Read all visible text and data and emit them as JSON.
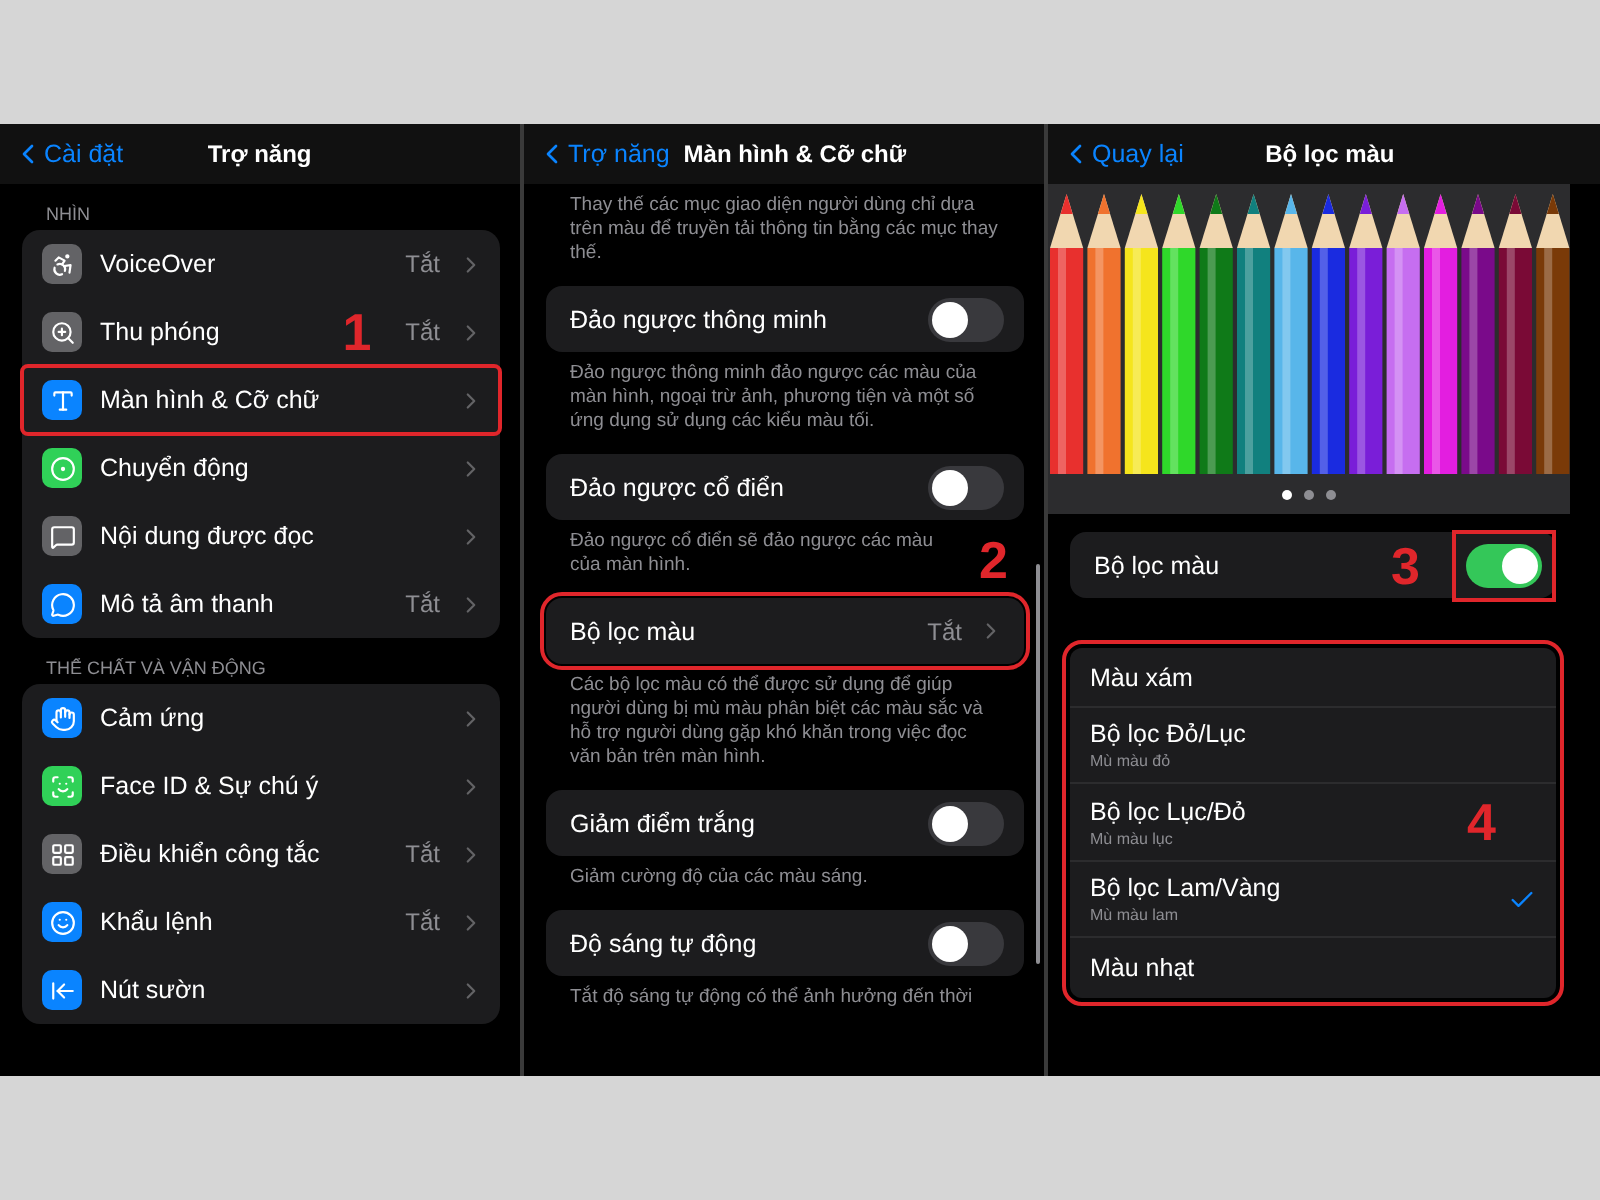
{
  "screens": [
    {
      "kind": "menu",
      "back": "Cài đặt",
      "title": "Trợ năng",
      "sections": [
        {
          "header": "NHÌN",
          "items": [
            {
              "label": "VoiceOver",
              "value": "Tắt",
              "color": "#636366",
              "highlighted": false
            },
            {
              "label": "Thu phóng",
              "value": "Tắt",
              "step": "1",
              "color": "#636366",
              "highlighted": false
            },
            {
              "label": "Màn hình & Cỡ chữ",
              "color": "#0a84ff",
              "highlighted": true
            },
            {
              "label": "Chuyển động",
              "color": "#30d158",
              "highlighted": false
            },
            {
              "label": "Nội dung được đọc",
              "color": "#636366",
              "highlighted": false
            },
            {
              "label": "Mô tả âm thanh",
              "value": "Tắt",
              "color": "#0a84ff",
              "highlighted": false
            }
          ]
        },
        {
          "header": "THỂ CHẤT VÀ VẬN ĐỘNG",
          "items": [
            {
              "label": "Cảm ứng",
              "color": "#0a84ff",
              "highlighted": false
            },
            {
              "label": "Face ID & Sự chú ý",
              "color": "#30d158",
              "highlighted": false
            },
            {
              "label": "Điều khiển công tắc",
              "value": "Tắt",
              "color": "#636366",
              "highlighted": false
            },
            {
              "label": "Khẩu lệnh",
              "value": "Tắt",
              "color": "#0a84ff",
              "highlighted": false
            },
            {
              "label": "Nút sườn",
              "color": "#0a84ff",
              "highlighted": false
            }
          ]
        }
      ]
    },
    {
      "kind": "settings",
      "back": "Trợ năng",
      "title": "Màn hình & Cỡ chữ",
      "blocks": [
        {
          "kind": "note",
          "text": "Thay thế các mục giao diện người dùng chỉ dựa trên màu để truyền tải thông tin bằng các mục thay thế."
        },
        {
          "kind": "toggle",
          "label": "Đảo ngược thông minh",
          "on": false
        },
        {
          "kind": "note",
          "text": "Đảo ngược thông minh đảo ngược các màu của màn hình, ngoại trừ ảnh, phương tiện và một số ứng dụng sử dụng các kiểu màu tối."
        },
        {
          "kind": "toggle",
          "label": "Đảo ngược cổ điển",
          "on": false
        },
        {
          "kind": "note",
          "text": "Đảo ngược cổ điển sẽ đảo ngược các màu của màn hình.",
          "step": "2"
        },
        {
          "kind": "link",
          "label": "Bộ lọc màu",
          "value": "Tắt",
          "highlighted": true
        },
        {
          "kind": "note",
          "text": "Các bộ lọc màu có thể được sử dụng để giúp người dùng bị mù màu phân biệt các màu sắc và hỗ trợ người dùng gặp khó khăn trong việc đọc văn bản trên màn hình."
        },
        {
          "kind": "toggle",
          "label": "Giảm điểm trắng",
          "on": false
        },
        {
          "kind": "note",
          "text": "Giảm cường độ của các màu sáng."
        },
        {
          "kind": "toggle",
          "label": "Độ sáng tự động",
          "on": false
        },
        {
          "kind": "note",
          "text": "Tắt độ sáng tự động có thể ảnh hưởng đến thời"
        }
      ]
    },
    {
      "kind": "filter",
      "back": "Quay lại",
      "title": "Bộ lọc màu",
      "pages": [
        {
          "selected": true
        },
        {
          "selected": false
        },
        {
          "selected": false
        }
      ],
      "toggle": {
        "label": "Bộ lọc màu",
        "step": "3",
        "on": true,
        "highlighted": true
      },
      "filters": {
        "highlighted": true,
        "items": [
          {
            "label": "Màu xám",
            "selected": false
          },
          {
            "label": "Bộ lọc Đỏ/Lục",
            "sublabel": "Mù màu đỏ",
            "selected": false
          },
          {
            "label": "Bộ lọc Lục/Đỏ",
            "sublabel": "Mù màu lục",
            "step": "4",
            "selected": false
          },
          {
            "label": "Bộ lọc Lam/Vàng",
            "sublabel": "Mù màu lam",
            "selected": true
          },
          {
            "label": "Màu nhạt",
            "selected": false
          }
        ]
      }
    }
  ]
}
